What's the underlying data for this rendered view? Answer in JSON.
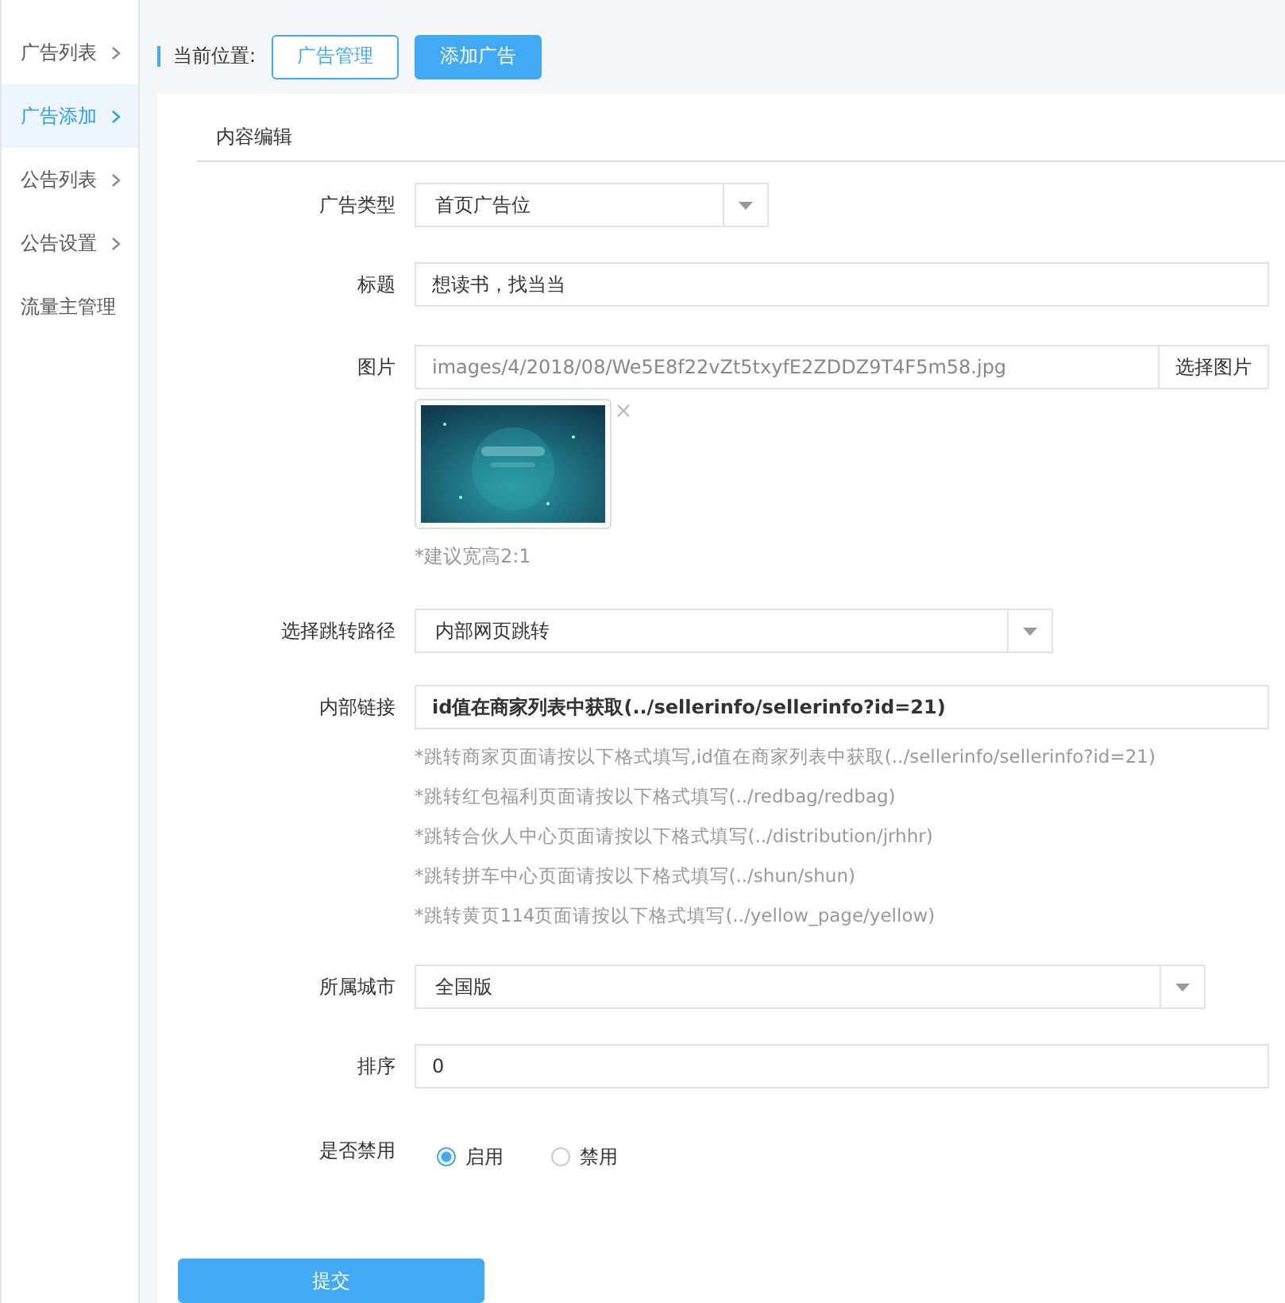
{
  "sidebar": {
    "items": [
      {
        "label": "广告列表",
        "kind": "submenu",
        "selected": false
      },
      {
        "label": "广告添加",
        "kind": "submenu",
        "selected": true
      },
      {
        "label": "公告列表",
        "kind": "submenu",
        "selected": false
      },
      {
        "label": "公告设置",
        "kind": "submenu",
        "selected": false
      },
      {
        "label": "流量主管理",
        "kind": "link",
        "selected": false
      }
    ]
  },
  "breadcrumb": {
    "label": "当前位置:",
    "items": [
      {
        "label": "广告管理",
        "selected": false
      },
      {
        "label": "添加广告",
        "selected": true
      }
    ]
  },
  "section_title": "内容编辑",
  "form": {
    "fields": [
      {
        "kind": "select",
        "label": "广告类型",
        "value": "首页广告位"
      },
      {
        "kind": "text",
        "label": "标题",
        "value": "想读书，找当当"
      },
      {
        "label": "图片",
        "value": "images/4/2018/08/We5E8f22vZt5txyfE2ZDDZ9T4F5m58.jpg",
        "button": "选择图片",
        "hint": "*建议宽高2:1"
      },
      {
        "kind": "select",
        "label": "选择跳转路径",
        "value": "内部网页跳转"
      },
      {
        "kind": "text",
        "label": "内部链接",
        "value": "id值在商家列表中获取(../sellerinfo/sellerinfo?id=21)",
        "hints": [
          "*跳转商家页面请按以下格式填写,id值在商家列表中获取(../sellerinfo/sellerinfo?id=21)",
          "*跳转红包福利页面请按以下格式填写(../redbag/redbag)",
          "*跳转合伙人中心页面请按以下格式填写(../distribution/jrhhr)",
          "*跳转拼车中心页面请按以下格式填写(../shun/shun)",
          "*跳转黄页114页面请按以下格式填写(../yellow_page/yellow)"
        ]
      },
      {
        "kind": "select",
        "label": "所属城市",
        "value": "全国版"
      },
      {
        "kind": "text",
        "label": "排序",
        "value": "0"
      },
      {
        "kind": "radio",
        "label": "是否禁用",
        "options": [
          {
            "label": "启用",
            "selected": true
          },
          {
            "label": "禁用",
            "selected": false
          }
        ]
      }
    ]
  },
  "submit": "提交"
}
